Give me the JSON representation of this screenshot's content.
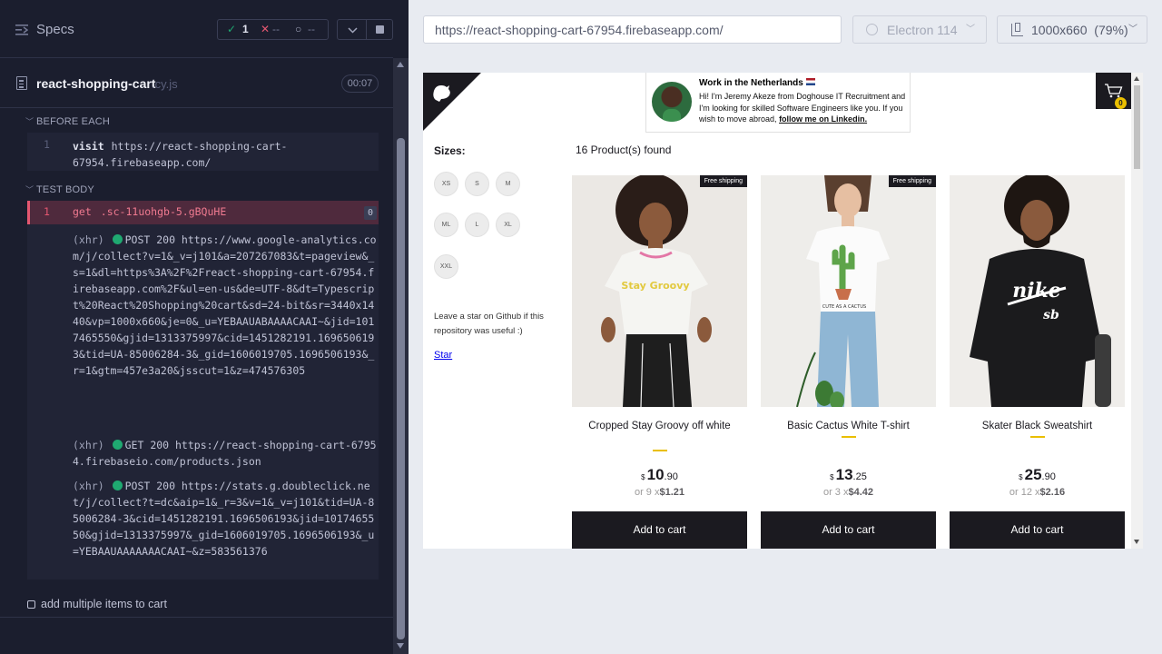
{
  "reporter": {
    "header": {
      "title": "Specs"
    },
    "stats": {
      "passed": "1",
      "failed": "--",
      "pending": "--"
    },
    "file": {
      "name": "react-shopping-cart",
      "ext": ".cy.js",
      "duration": "00:07"
    },
    "before_each": {
      "label": "BEFORE EACH",
      "commands": [
        {
          "num": "1",
          "name": "visit",
          "arg": "https://react-shopping-cart-67954.firebaseapp.com/"
        }
      ]
    },
    "test_body": {
      "label": "TEST BODY",
      "get": {
        "num": "1",
        "name": "get",
        "arg": ".sc-11uohgb-5.gBQuHE",
        "count": "0"
      },
      "xhrs": [
        {
          "tag": "(xhr)",
          "text": "POST 200 https://www.google-analytics.com/j/collect?v=1&_v=j101&a=207267083&t=pageview&_s=1&dl=https%3A%2F%2Freact-shopping-cart-67954.firebaseapp.com%2F&ul=en-us&de=UTF-8&dt=Typescript%20React%20Shopping%20cart&sd=24-bit&sr=3440x1440&vp=1000x660&je=0&_u=YEBAAUABAAAACAAI~&jid=1017465550&gjid=1313375997&cid=1451282191.1696506193&tid=UA-85006284-3&_gid=1606019705.1696506193&_r=1&gtm=457e3a20&jsscut=1&z=474576305"
        },
        {
          "tag": "(xhr)",
          "text": "GET 200 https://react-shopping-cart-67954.firebaseio.com/products.json"
        },
        {
          "tag": "(xhr)",
          "text": "POST 200 https://stats.g.doubleclick.net/j/collect?t=dc&aip=1&_r=3&v=1&_v=j101&tid=UA-85006284-3&cid=1451282191.1696506193&jid=1017465550&gjid=1313375997&_gid=1606019705.1696506193&_u=YEBAAUAAAAAAACAAI~&z=583561376"
        }
      ]
    },
    "next_test": "add multiple items to cart"
  },
  "toolbar": {
    "url": "https://react-shopping-cart-67954.firebaseapp.com/",
    "browser": "Electron 114",
    "viewport": "1000x660",
    "zoom": "(79%)"
  },
  "app": {
    "banner": {
      "title": "Work in the Netherlands",
      "text": "Hi! I'm Jeremy Akeze from Doghouse IT Recruitment and I'm looking for skilled Software Engineers like you. If you wish to move abroad,",
      "link": "follow me on Linkedin."
    },
    "cart_count": "0",
    "sizes": {
      "title": "Sizes:",
      "options": [
        "XS",
        "S",
        "M",
        "ML",
        "L",
        "XL",
        "XXL"
      ]
    },
    "star_text": "Leave a star on Github if this repository was useful :)",
    "star_link": "Star",
    "products_found": "16 Product(s) found",
    "products": [
      {
        "title": "Cropped Stay Groovy off white",
        "currency": "$",
        "price_int": "10",
        "price_cents": ".90",
        "install_prefix": "or 9 x",
        "install_value": "$1.21",
        "badge": "Free shipping",
        "button": "Add to cart"
      },
      {
        "title": "Basic Cactus White T-shirt",
        "currency": "$",
        "price_int": "13",
        "price_cents": ".25",
        "install_prefix": "or 3 x",
        "install_value": "$4.42",
        "badge": "Free shipping",
        "button": "Add to cart"
      },
      {
        "title": "Skater Black Sweatshirt",
        "currency": "$",
        "price_int": "25",
        "price_cents": ".90",
        "install_prefix": "or 12 x",
        "install_value": "$2.16",
        "badge": "",
        "button": "Add to cart"
      }
    ],
    "product_art": {
      "p0_caption": "Stay Groovy",
      "p1_caption": "CUTE AS A CACTUS",
      "p2_logo": "nike",
      "p2_sub": "sb"
    }
  },
  "colors": {
    "pass": "#1fa971",
    "fail": "#e45770",
    "accent": "#eabf00",
    "dark": "#1b1a20"
  }
}
